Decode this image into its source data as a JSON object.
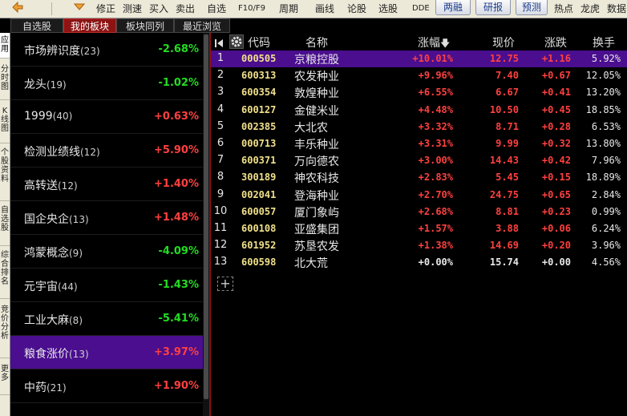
{
  "toolbar": {
    "items": [
      "修正",
      "测速",
      "买入",
      "卖出",
      "自选",
      "F10/F9",
      "周期",
      "画线",
      "论股",
      "选股",
      "DDE"
    ],
    "boxes": [
      "两融",
      "研报",
      "预测"
    ],
    "right_items": [
      "热点",
      "龙虎",
      "数据"
    ]
  },
  "tabs": [
    "自选股",
    "我的板块",
    "板块同列",
    "最近浏览"
  ],
  "side_tabs": [
    "应用",
    "分时图",
    "K线图",
    "个股资料",
    "自选股",
    "综合排名",
    "竞价分析",
    "更多"
  ],
  "sectors": [
    {
      "name": "市场辨识度",
      "count": "(23)",
      "pct": "-2.68%",
      "dir": "down"
    },
    {
      "name": "龙头",
      "count": "(19)",
      "pct": "-1.02%",
      "dir": "down"
    },
    {
      "name": "1999",
      "count": "(40)",
      "pct": "+0.63%",
      "dir": "up"
    },
    {
      "name": "检测业绩线",
      "count": "(12)",
      "pct": "+5.90%",
      "dir": "up"
    },
    {
      "name": "高转送",
      "count": "(12)",
      "pct": "+1.40%",
      "dir": "up"
    },
    {
      "name": "国企央企",
      "count": "(13)",
      "pct": "+1.48%",
      "dir": "up"
    },
    {
      "name": "鸿蒙概念",
      "count": "(9)",
      "pct": "-4.09%",
      "dir": "down"
    },
    {
      "name": "元宇宙",
      "count": "(44)",
      "pct": "-1.43%",
      "dir": "down"
    },
    {
      "name": "工业大麻",
      "count": "(8)",
      "pct": "-5.41%",
      "dir": "down"
    },
    {
      "name": "粮食涨价",
      "count": "(13)",
      "pct": "+3.97%",
      "dir": "up",
      "selected": true
    },
    {
      "name": "中药",
      "count": "(21)",
      "pct": "+1.90%",
      "dir": "up"
    }
  ],
  "table": {
    "headers": {
      "code": "代码",
      "name": "名称",
      "pct": "涨幅",
      "sort_arrow": "🡇",
      "price": "现价",
      "change": "涨跌",
      "turnover": "换手"
    },
    "rows": [
      {
        "idx": "1",
        "code": "000505",
        "name": "京粮控股",
        "pct": "+10.01%",
        "price": "12.75",
        "change": "+1.16",
        "turnover": "5.92%",
        "dir": "up",
        "selected": true
      },
      {
        "idx": "2",
        "code": "600313",
        "name": "农发种业",
        "pct": "+9.96%",
        "price": "7.40",
        "change": "+0.67",
        "turnover": "12.05%",
        "dir": "up"
      },
      {
        "idx": "3",
        "code": "600354",
        "name": "敦煌种业",
        "pct": "+6.55%",
        "price": "6.67",
        "change": "+0.41",
        "turnover": "13.20%",
        "dir": "up"
      },
      {
        "idx": "4",
        "code": "600127",
        "name": "金健米业",
        "pct": "+4.48%",
        "price": "10.50",
        "change": "+0.45",
        "turnover": "18.85%",
        "dir": "up"
      },
      {
        "idx": "5",
        "code": "002385",
        "name": "大北农",
        "pct": "+3.32%",
        "price": "8.71",
        "change": "+0.28",
        "turnover": "6.53%",
        "dir": "up"
      },
      {
        "idx": "6",
        "code": "000713",
        "name": "丰乐种业",
        "pct": "+3.31%",
        "price": "9.99",
        "change": "+0.32",
        "turnover": "13.80%",
        "dir": "up"
      },
      {
        "idx": "7",
        "code": "600371",
        "name": "万向德农",
        "pct": "+3.00%",
        "price": "14.43",
        "change": "+0.42",
        "turnover": "7.96%",
        "dir": "up"
      },
      {
        "idx": "8",
        "code": "300189",
        "name": "神农科技",
        "pct": "+2.83%",
        "price": "5.45",
        "change": "+0.15",
        "turnover": "18.89%",
        "dir": "up"
      },
      {
        "idx": "9",
        "code": "002041",
        "name": "登海种业",
        "pct": "+2.70%",
        "price": "24.75",
        "change": "+0.65",
        "turnover": "2.84%",
        "dir": "up"
      },
      {
        "idx": "10",
        "code": "600057",
        "name": "厦门象屿",
        "pct": "+2.68%",
        "price": "8.81",
        "change": "+0.23",
        "turnover": "0.99%",
        "dir": "up"
      },
      {
        "idx": "11",
        "code": "600108",
        "name": "亚盛集团",
        "pct": "+1.57%",
        "price": "3.88",
        "change": "+0.06",
        "turnover": "6.24%",
        "dir": "up"
      },
      {
        "idx": "12",
        "code": "601952",
        "name": "苏垦农发",
        "pct": "+1.38%",
        "price": "14.69",
        "change": "+0.20",
        "turnover": "3.96%",
        "dir": "up"
      },
      {
        "idx": "13",
        "code": "600598",
        "name": "北大荒",
        "pct": "+0.00%",
        "price": "15.74",
        "change": "+0.00",
        "turnover": "4.56%",
        "dir": "flat"
      }
    ],
    "add_label": "+"
  },
  "colors": {
    "up": "#ff4040",
    "down": "#22dd22",
    "flat": "#e8e8e8",
    "selected_bg": "#4a0e8f",
    "active_tab": "#8e1414"
  }
}
